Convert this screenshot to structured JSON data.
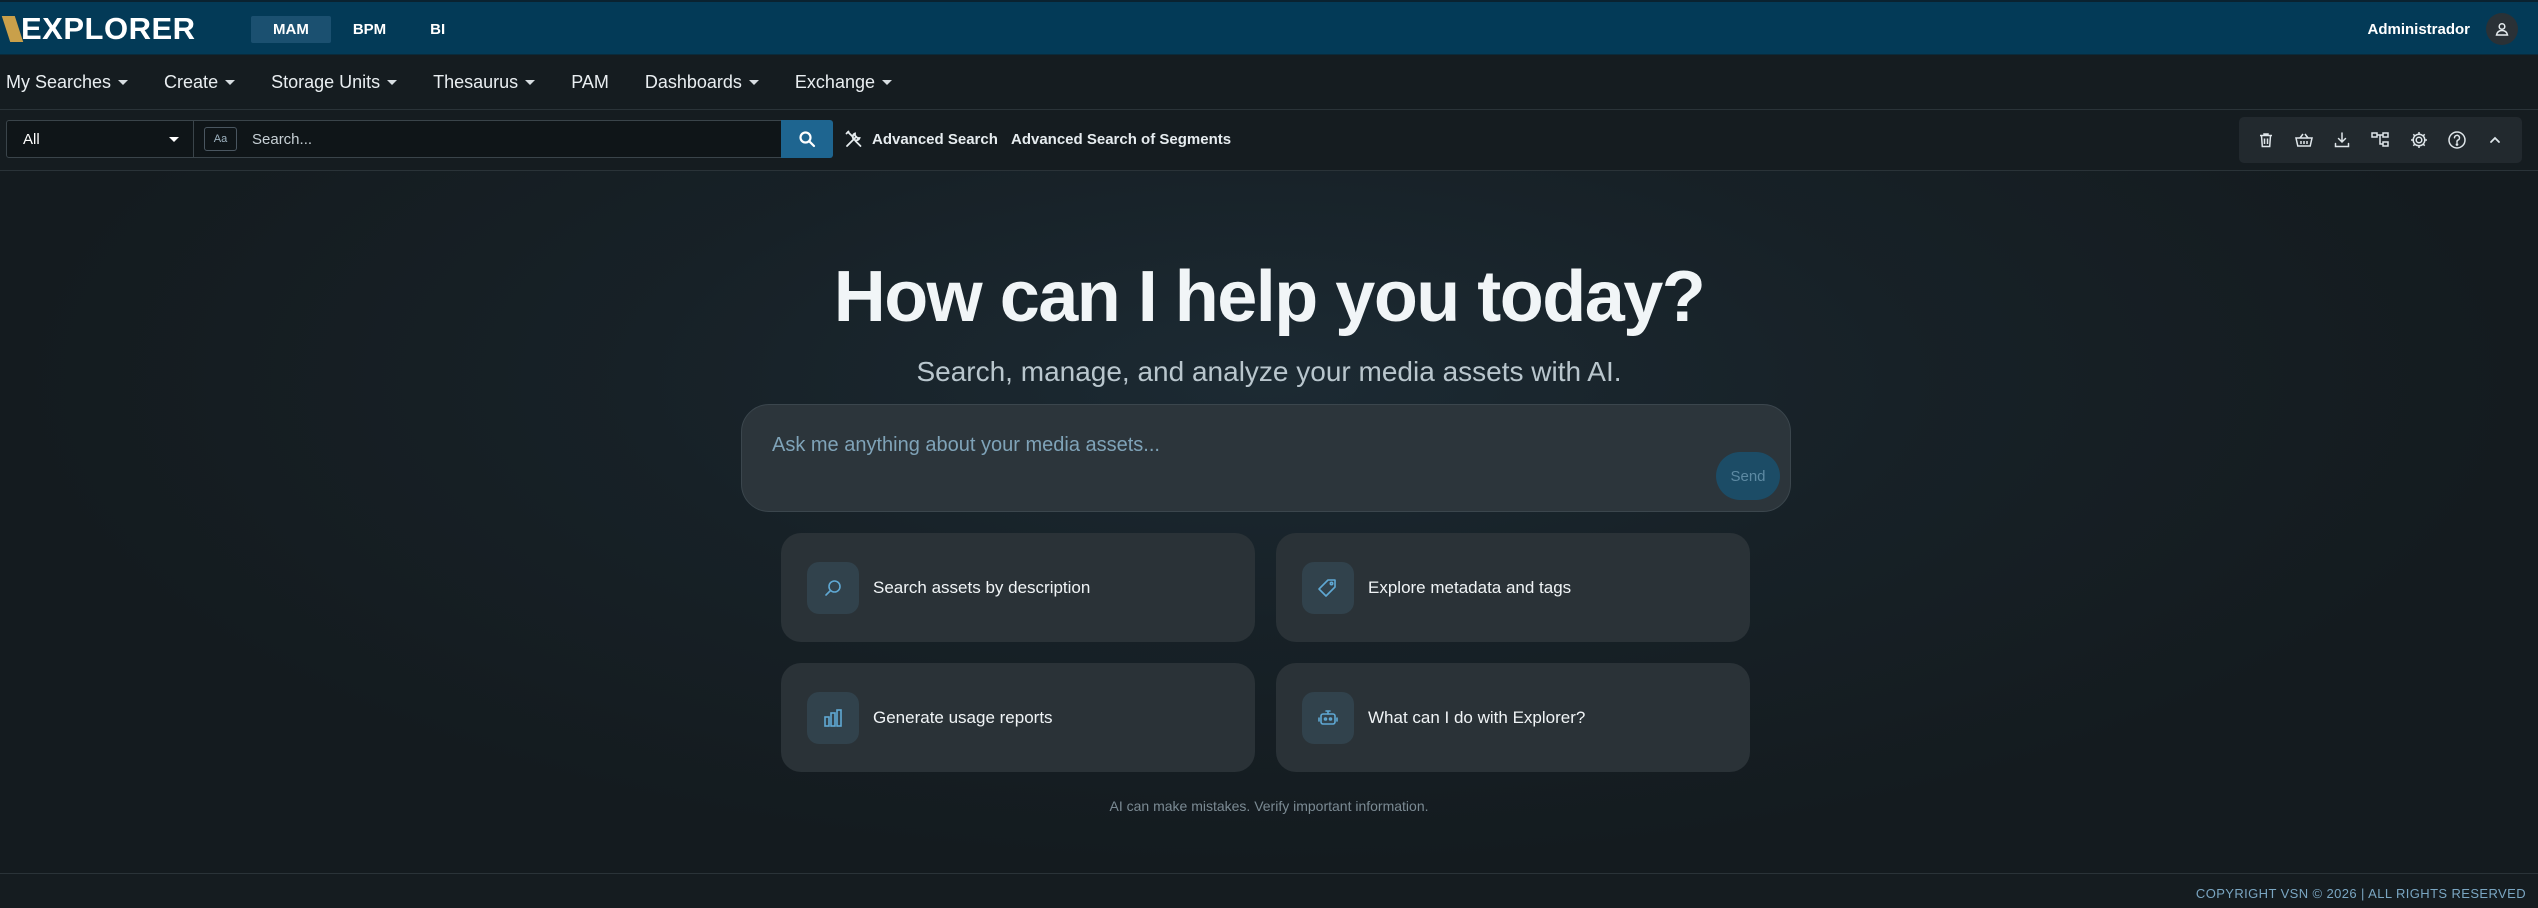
{
  "app": {
    "logo_text": "EXPLORER",
    "modules": [
      "MAM",
      "BPM",
      "BI"
    ],
    "active_module": "MAM",
    "user_name": "Administrador"
  },
  "menu": {
    "items": [
      {
        "label": "My Searches",
        "dropdown": true
      },
      {
        "label": "Create",
        "dropdown": true
      },
      {
        "label": "Storage Units",
        "dropdown": true
      },
      {
        "label": "Thesaurus",
        "dropdown": true
      },
      {
        "label": "PAM",
        "dropdown": false
      },
      {
        "label": "Dashboards",
        "dropdown": true
      },
      {
        "label": "Exchange",
        "dropdown": true
      }
    ]
  },
  "search": {
    "scope_value": "All",
    "case_toggle_label": "Aa",
    "placeholder": "Search...",
    "value": "",
    "advanced_search_label": "Advanced Search",
    "advanced_segments_label": "Advanced Search of Segments",
    "toolbar_icons": [
      "trash-icon",
      "basket-icon",
      "download-icon",
      "hierarchy-icon",
      "gear-icon",
      "help-icon",
      "chevron-up-icon"
    ]
  },
  "assistant": {
    "title": "How can I help you today?",
    "subtitle": "Search, manage, and analyze your media assets with AI.",
    "input_placeholder": "Ask me anything about your media assets...",
    "send_label": "Send",
    "suggestions": [
      {
        "label": "Search assets by description",
        "icon": "search-icon"
      },
      {
        "label": "Explore metadata and tags",
        "icon": "tag-icon"
      },
      {
        "label": "Generate usage reports",
        "icon": "bar-chart-icon"
      },
      {
        "label": "What can I do with Explorer?",
        "icon": "robot-icon"
      }
    ],
    "disclaimer": "AI can make mistakes. Verify important information."
  },
  "footer": {
    "copyright": "COPYRIGHT VSN © 2026 | ALL RIGHTS RESERVED"
  },
  "colors": {
    "topbar": "#033a57",
    "accent": "#1e6590",
    "logo_accent": "#c9a04a",
    "background": "#151c20"
  }
}
